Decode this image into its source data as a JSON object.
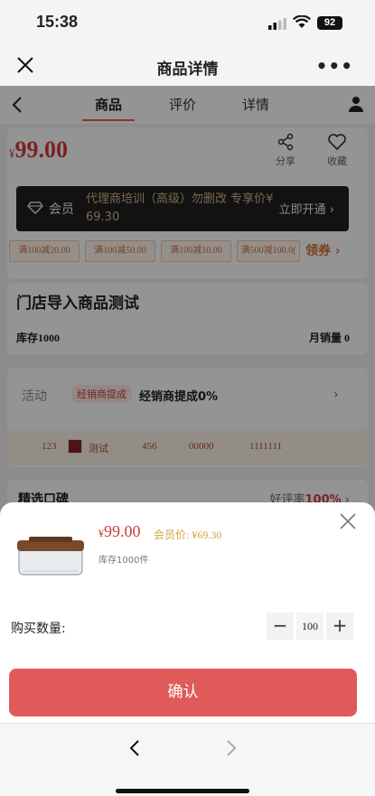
{
  "status_bar": {
    "time": "15:38",
    "battery": "92"
  },
  "mini_program_bar": {
    "title": "商品详情"
  },
  "tabs": [
    {
      "label": "商品",
      "active": true
    },
    {
      "label": "评价",
      "active": false
    },
    {
      "label": "详情",
      "active": false
    }
  ],
  "product": {
    "currency": "¥",
    "price": "99.00",
    "share_label": "分享",
    "favorite_label": "收藏",
    "member": {
      "label": "会员",
      "description": "代理商培训（高级）勿删改 专享价¥ 69.30",
      "open_label": "立即开通"
    },
    "coupons": [
      "满100减20.00",
      "满100减50.00",
      "满100减10.00",
      "满500减100.0("
    ],
    "coupon_get_label": "领券",
    "title": "门店导入商品测试",
    "stock": "库存1000",
    "monthly_sales": "月销量 0",
    "activity": {
      "label": "活动",
      "tag": "经销商提成",
      "description": "经销商提成0%"
    },
    "specs": [
      "123",
      "测试",
      "456",
      "00000",
      "1111111"
    ],
    "reviews": {
      "label": "精选口碑",
      "rate_prefix": "好评率",
      "rate_value": "100%"
    }
  },
  "sheet": {
    "currency": "¥",
    "price": "99.00",
    "member_price": "会员价: ¥69.30",
    "stock": "库存1000件",
    "quantity_label": "购买数量:",
    "quantity": "100",
    "confirm_label": "确认"
  },
  "colors": {
    "accent": "#e05a59",
    "price": "#d23b3b",
    "coupon": "#d4703a",
    "member_bg": "#1f1f1f"
  }
}
